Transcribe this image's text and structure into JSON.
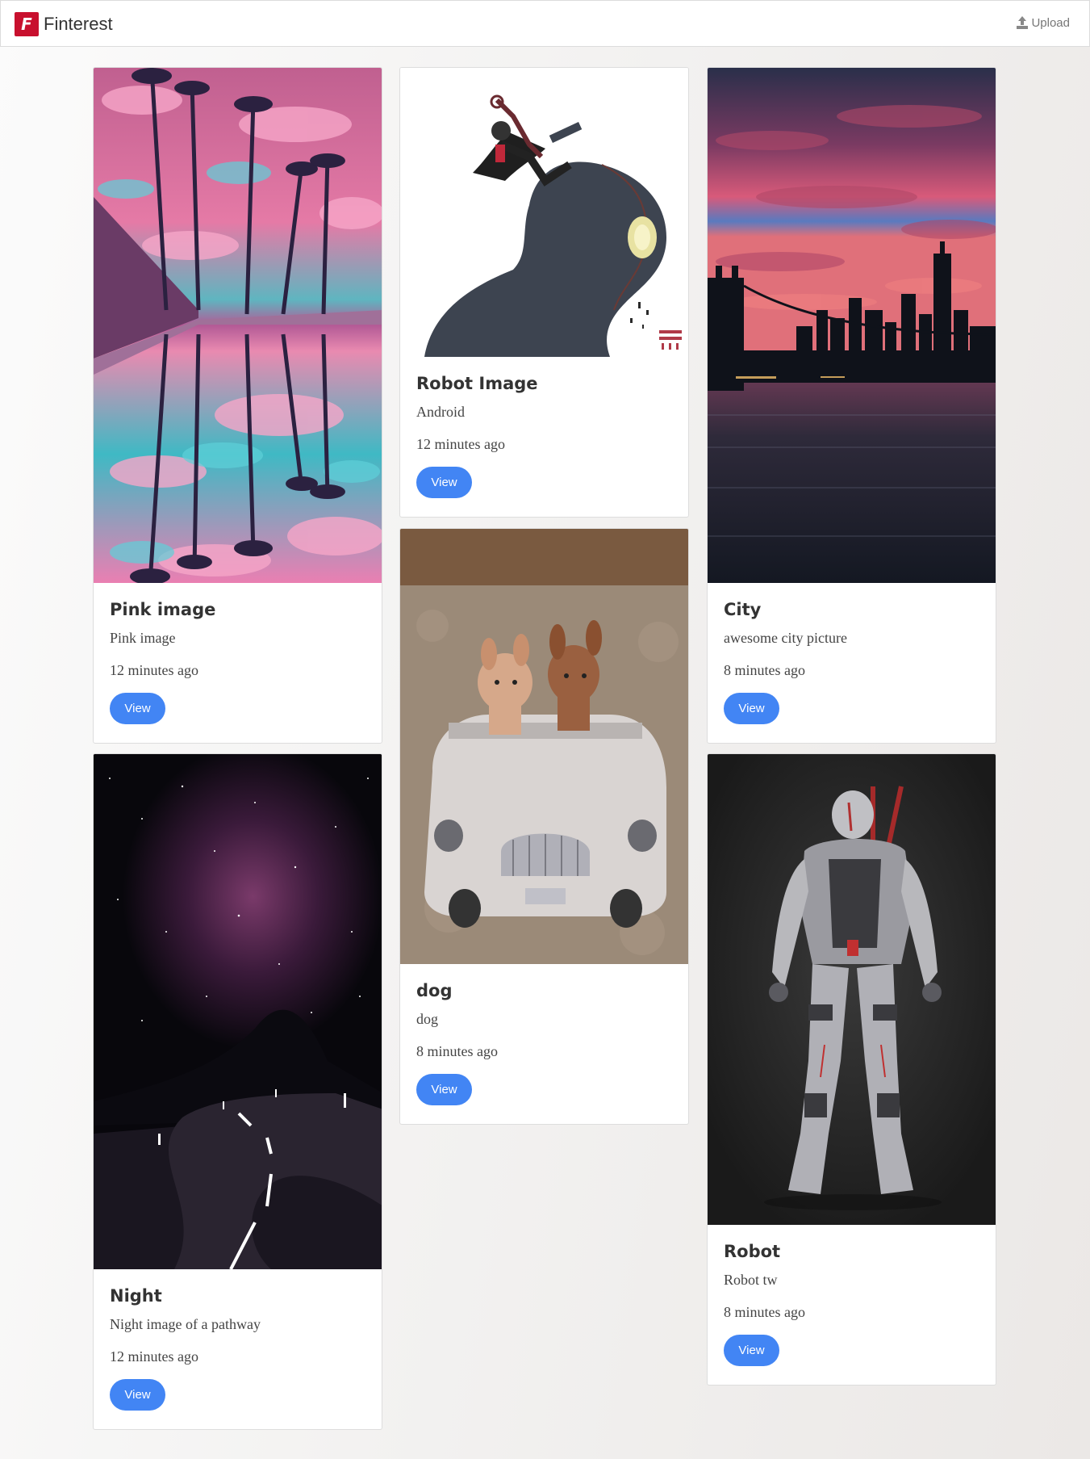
{
  "app": {
    "logo_letter": "F",
    "brand_name": "Finterest",
    "upload_label": "Upload",
    "accent_color": "#4285f4",
    "logo_color": "#c8102e"
  },
  "cards": [
    {
      "title": "Pink image",
      "description": "Pink image",
      "time": "12 minutes ago",
      "button": "View"
    },
    {
      "title": "Robot Image",
      "description": "Android",
      "time": "12 minutes ago",
      "button": "View"
    },
    {
      "title": "City",
      "description": "awesome city picture",
      "time": "8 minutes ago",
      "button": "View"
    },
    {
      "title": "dog",
      "description": "dog",
      "time": "8 minutes ago",
      "button": "View"
    },
    {
      "title": "Night",
      "description": "Night image of a pathway",
      "time": "12 minutes ago",
      "button": "View"
    },
    {
      "title": "Robot",
      "description": "Robot tw",
      "time": "8 minutes ago",
      "button": "View"
    }
  ]
}
